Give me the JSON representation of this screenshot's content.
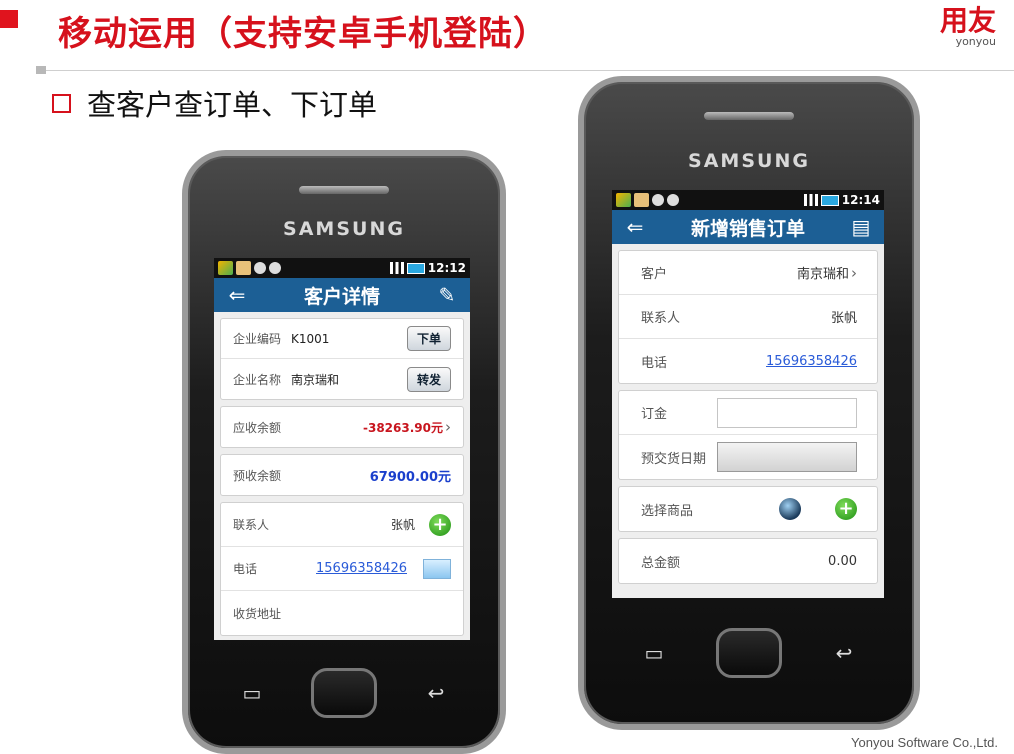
{
  "slide": {
    "title": "移动运用（支持安卓手机登陆）",
    "bullet": "查客户查订单、下订单",
    "logo_cn": "用友",
    "logo_en": "yonyou",
    "footer": "Yonyou Software Co.,Ltd.",
    "accent_color": "#d6111c"
  },
  "phone1": {
    "brand": "SAMSUNG",
    "time": "12:12",
    "header_title": "客户详情",
    "back_icon": "back-arrow-icon",
    "edit_icon": "edit-icon",
    "code_label": "企业编码",
    "code_value": "K1001",
    "order_button": "下单",
    "name_label": "企业名称",
    "name_value": "南京瑞和",
    "forward_button": "转发",
    "receivable_label": "应收余额",
    "receivable_value": "-38263.90元",
    "prepaid_label": "预收余额",
    "prepaid_value": "67900.00元",
    "contact_label": "联系人",
    "contact_value": "张帆",
    "phone_label": "电话",
    "phone_value": "15696358426",
    "address_label": "收货地址"
  },
  "phone2": {
    "brand": "SAMSUNG",
    "time": "12:14",
    "header_title": "新增销售订单",
    "back_icon": "back-arrow-icon",
    "save_icon": "save-icon",
    "customer_label": "客户",
    "customer_value": "南京瑞和",
    "contact_label": "联系人",
    "contact_value": "张帆",
    "phone_label": "电话",
    "phone_value": "15696358426",
    "deposit_label": "订金",
    "deposit_value": "",
    "delivery_label": "预交货日期",
    "delivery_value": "",
    "goods_label": "选择商品",
    "total_label": "总金额",
    "total_value": "0.00"
  },
  "colors": {
    "appbar": "#1c5f95",
    "negative_amount": "#c8151e",
    "positive_amount": "#1a3fcc",
    "link": "#2a5bd8"
  }
}
